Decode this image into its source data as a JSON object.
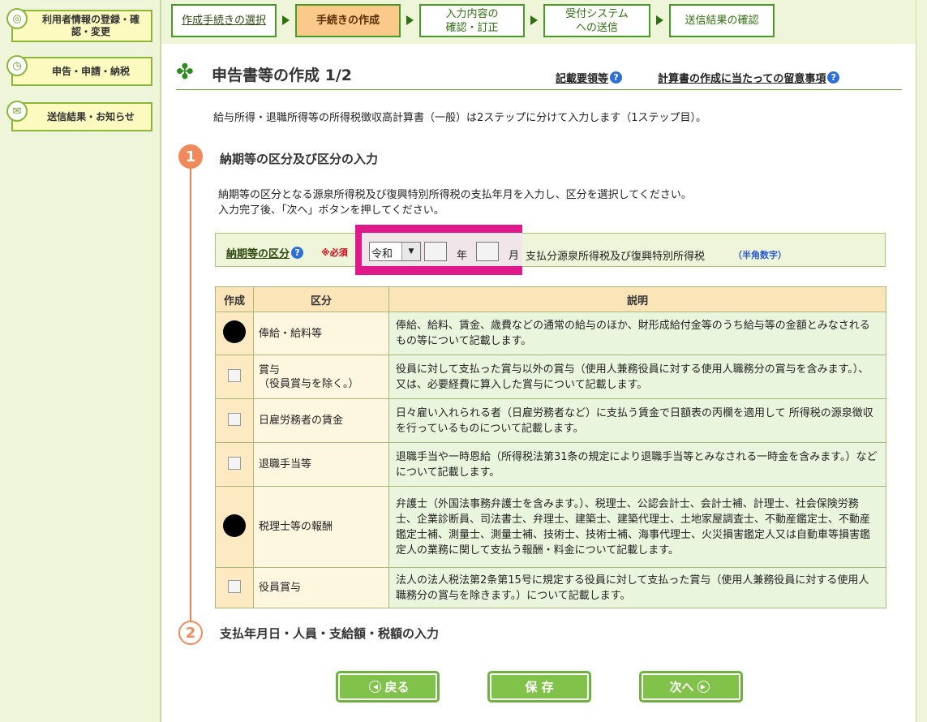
{
  "sidebar": {
    "items": [
      {
        "label": "利用者情報の登録・確認・変更",
        "icon": "user-registration-icon"
      },
      {
        "label": "申告・申請・納税",
        "icon": "clock-icon"
      },
      {
        "label": "送信結果・お知らせ",
        "icon": "mail-icon"
      }
    ]
  },
  "steps": [
    {
      "label": "作成手続きの選択",
      "state": "link"
    },
    {
      "label": "手続きの作成",
      "state": "active"
    },
    {
      "label": "入力内容の確認・訂正",
      "state": "pending"
    },
    {
      "label": "受付システムへの送信",
      "state": "pending"
    },
    {
      "label": "送信結果の確認",
      "state": "pending"
    }
  ],
  "header": {
    "title": "申告書等の作成 1/2",
    "links": [
      "記載要領等",
      "計算書の作成に当たっての留意事項"
    ]
  },
  "intro": "給与所得・退職所得等の所得税徴収高計算書（一般）は2ステップに分けて入力します（1ステップ目）。",
  "section1": {
    "number": "1",
    "title": "納期等の区分及び区分の入力",
    "desc1": "納期等の区分となる源泉所得税及び復興特別所得税の支払年月を入力し、区分を選択してください。",
    "desc2": "入力完了後、「次へ」ボタンを押してください。"
  },
  "period": {
    "label": "納期等の区分",
    "required": "※必須",
    "era": "令和",
    "year_value": "",
    "month_value": "",
    "year_unit": "年",
    "month_unit": "月",
    "suffix": "支払分源泉所得税及び復興特別所得税",
    "note": "（半角数字）"
  },
  "table": {
    "headers": [
      "作成",
      "区分",
      "説明"
    ],
    "rows": [
      {
        "make": "dot",
        "kubun": "俸給・給料等",
        "desc": "俸給、給料、賃金、歳費などの通常の給与のほか、財形成給付金等のうち給与等の金額とみなされるもの等について記載します。"
      },
      {
        "make": "checkbox",
        "kubun": "賞与\n（役員賞与を除く。）",
        "desc": "役員に対して支払った賞与以外の賞与（使用人兼務役員に対する使用人職務分の賞与を含みます。）、又は、必要経費に算入した賞与について記載します。"
      },
      {
        "make": "checkbox",
        "kubun": "日雇労務者の賃金",
        "desc": "日々雇い入れられる者（日雇労務者など）に支払う賃金で日額表の丙欄を適用して 所得税の源泉徴収を行っているものについて記載します。"
      },
      {
        "make": "checkbox",
        "kubun": "退職手当等",
        "desc": "退職手当や一時恩給（所得税法第31条の規定により退職手当等とみなされる一時金を含みます。）などについて記載します。"
      },
      {
        "make": "dot",
        "kubun": "税理士等の報酬",
        "desc": "弁護士（外国法事務弁護士を含みます。）、税理士、公認会計士、会計士補、計理士、社会保険労務士、企業診断員、司法書士、弁理士、建築士、建築代理士、土地家屋調査士、不動産鑑定士、不動産鑑定士補、測量士、測量士補、技術士、技術士補、海事代理士、火災損害鑑定人又は自動車等損害鑑定人の業務に関して支払う報酬・料金について記載します。"
      },
      {
        "make": "checkbox",
        "kubun": "役員賞与",
        "desc": "法人の法人税法第2条第15号に規定する役員に対して支払った賞与（使用人兼務役員に対する使用人職務分の賞与を除きます。）について記載します。"
      }
    ]
  },
  "section2": {
    "number": "2",
    "title": "支払年月日・人員・支給額・税額の入力"
  },
  "buttons": {
    "back": "戻る",
    "save": "保 存",
    "next": "次へ"
  },
  "colors": {
    "accent_green": "#4a9a28",
    "step_active": "#fbc98a",
    "highlight_pink": "#e0188a",
    "timeline_orange": "#f08a5b"
  }
}
